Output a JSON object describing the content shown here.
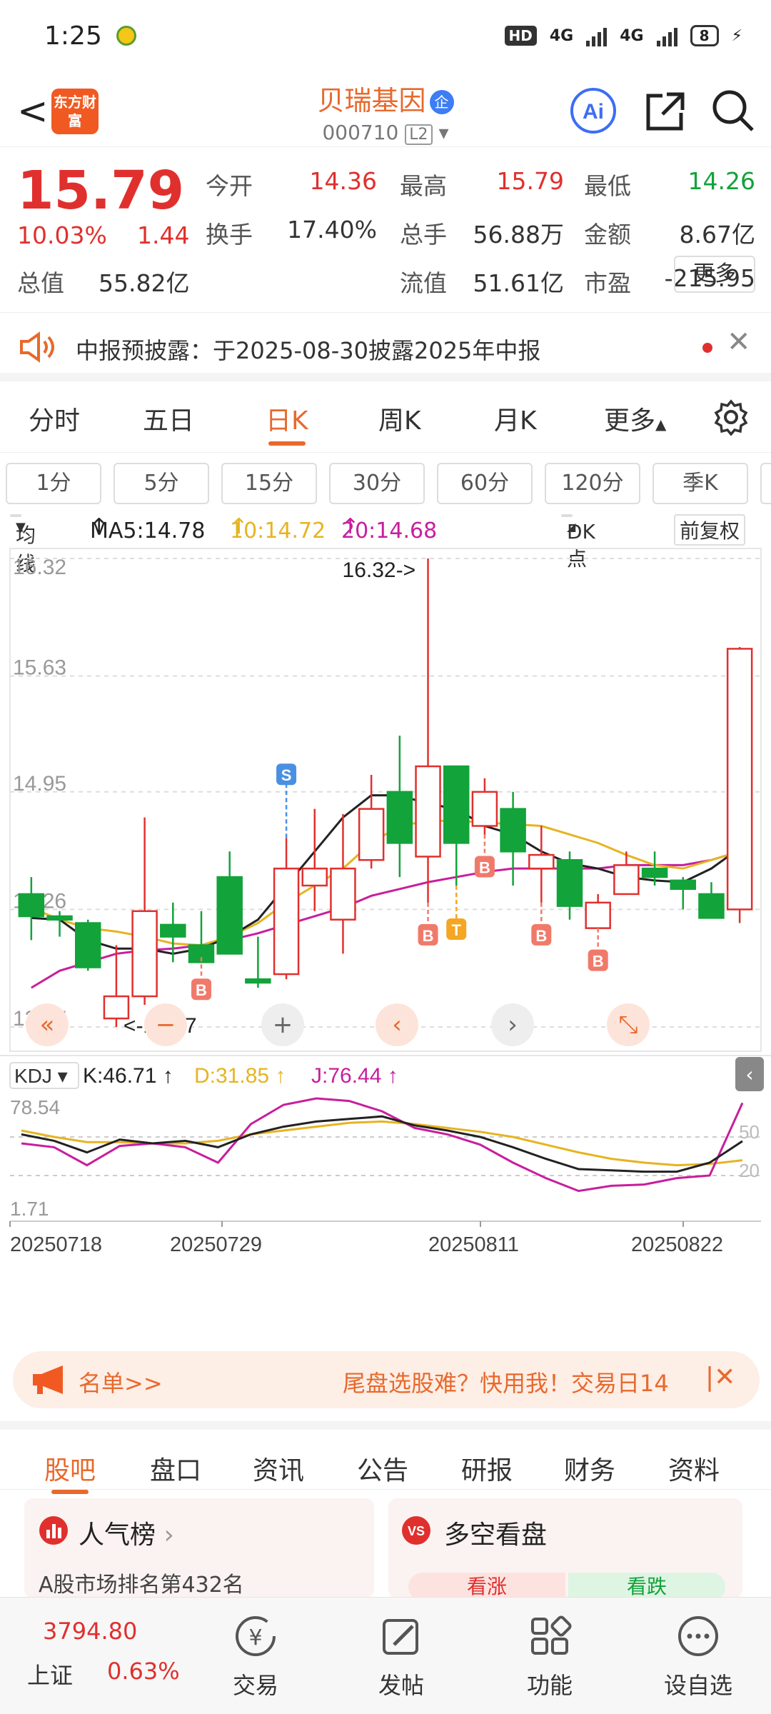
{
  "status": {
    "time": "1:25",
    "hd": "HD",
    "net1": "4G",
    "net2": "4G",
    "battery": "8"
  },
  "nav": {
    "logo": "东方财富",
    "name": "贝瑞基因",
    "badge": "企",
    "code": "000710",
    "level": "L2"
  },
  "quote": {
    "price": "15.79",
    "change_pct": "10.03%",
    "change": "1.44",
    "fields": [
      {
        "label": "今开",
        "value": "14.36",
        "color": "red"
      },
      {
        "label": "最高",
        "value": "15.79",
        "color": "red"
      },
      {
        "label": "最低",
        "value": "14.26",
        "color": "green"
      },
      {
        "label": "换手",
        "value": "17.40%",
        "color": "dark"
      },
      {
        "label": "总手",
        "value": "56.88万",
        "color": "dark"
      },
      {
        "label": "金额",
        "value": "8.67亿",
        "color": "dark"
      },
      {
        "label": "总值",
        "value": "55.82亿",
        "color": "dark"
      },
      {
        "label": "流值",
        "value": "51.61亿",
        "color": "dark"
      },
      {
        "label": "市盈",
        "value": "-215.95",
        "color": "dark"
      }
    ],
    "more": "更多"
  },
  "notice": {
    "text": "中报预披露：于2025-08-30披露2025年中报"
  },
  "chart_tabs": [
    "分时",
    "五日",
    "日K",
    "周K",
    "月K",
    "更多"
  ],
  "active_chart_tab": "日K",
  "periods": [
    "1分",
    "5分",
    "15分",
    "30分",
    "60分",
    "120分",
    "季K"
  ],
  "ma": {
    "selector": "均线",
    "ma5": "MA5:14.78",
    "ma10": "10:14.72",
    "ma20": "20:14.68",
    "dk": "DK点",
    "adjust": "前复权"
  },
  "kdj": {
    "selector": "KDJ",
    "k": "K:46.71",
    "d": "D:31.85",
    "j": "J:76.44"
  },
  "colors": {
    "up": "#e0302e",
    "down": "#12a33a",
    "accent": "#e8692c",
    "ma5": "#222222",
    "ma10": "#e6b422",
    "ma20": "#c81e9c"
  },
  "chart_data": {
    "type": "candlestick",
    "y_ticks": [
      "16.32",
      "15.63",
      "14.95",
      "14.26",
      "13.57"
    ],
    "ylim": [
      13.57,
      16.32
    ],
    "max_label": "16.32->",
    "min_label": "<-13.57",
    "x_labels": [
      "20250718",
      "20250729",
      "20250811",
      "20250822"
    ],
    "candles": [
      {
        "o": 14.35,
        "h": 14.45,
        "l": 14.08,
        "c": 14.22
      },
      {
        "o": 14.22,
        "h": 14.25,
        "l": 14.1,
        "c": 14.2
      },
      {
        "o": 14.18,
        "h": 14.2,
        "l": 13.9,
        "c": 13.92
      },
      {
        "o": 13.62,
        "h": 14.05,
        "l": 13.57,
        "c": 13.75
      },
      {
        "o": 13.75,
        "h": 14.8,
        "l": 13.7,
        "c": 14.25
      },
      {
        "o": 14.17,
        "h": 14.3,
        "l": 13.95,
        "c": 14.1
      },
      {
        "o": 14.05,
        "h": 14.25,
        "l": 13.98,
        "c": 13.95
      },
      {
        "o": 14.45,
        "h": 14.6,
        "l": 14.0,
        "c": 14.0
      },
      {
        "o": 13.85,
        "h": 14.1,
        "l": 13.8,
        "c": 13.83
      },
      {
        "o": 13.88,
        "h": 14.68,
        "l": 13.85,
        "c": 14.5
      },
      {
        "o": 14.4,
        "h": 14.85,
        "l": 14.25,
        "c": 14.5
      },
      {
        "o": 14.2,
        "h": 14.82,
        "l": 14.0,
        "c": 14.5
      },
      {
        "o": 14.55,
        "h": 15.05,
        "l": 14.5,
        "c": 14.85
      },
      {
        "o": 14.95,
        "h": 15.28,
        "l": 14.45,
        "c": 14.65
      },
      {
        "o": 14.57,
        "h": 16.32,
        "l": 14.3,
        "c": 15.1
      },
      {
        "o": 15.1,
        "h": 15.0,
        "l": 14.4,
        "c": 14.65
      },
      {
        "o": 14.75,
        "h": 15.03,
        "l": 14.7,
        "c": 14.95
      },
      {
        "o": 14.85,
        "h": 14.95,
        "l": 14.4,
        "c": 14.6
      },
      {
        "o": 14.5,
        "h": 14.75,
        "l": 14.3,
        "c": 14.58
      },
      {
        "o": 14.55,
        "h": 14.6,
        "l": 14.2,
        "c": 14.28
      },
      {
        "o": 14.15,
        "h": 14.35,
        "l": 14.15,
        "c": 14.3
      },
      {
        "o": 14.35,
        "h": 14.6,
        "l": 14.35,
        "c": 14.52
      },
      {
        "o": 14.5,
        "h": 14.6,
        "l": 14.4,
        "c": 14.45
      },
      {
        "o": 14.43,
        "h": 14.45,
        "l": 14.26,
        "c": 14.38
      },
      {
        "o": 14.35,
        "h": 14.42,
        "l": 14.23,
        "c": 14.21
      },
      {
        "o": 14.26,
        "h": 15.8,
        "l": 14.18,
        "c": 15.79
      }
    ],
    "ma5": [
      14.21,
      14.2,
      14.08,
      14.03,
      14.03,
      14.0,
      14.03,
      14.1,
      14.2,
      14.4,
      14.6,
      14.8,
      14.93,
      14.93,
      14.88,
      14.85,
      14.75,
      14.7,
      14.6,
      14.53,
      14.5,
      14.45,
      14.43,
      14.42,
      14.5,
      14.62
    ],
    "ma10": [
      14.27,
      14.2,
      14.15,
      14.13,
      14.1,
      14.06,
      14.05,
      14.1,
      14.18,
      14.3,
      14.4,
      14.5,
      14.65,
      14.75,
      14.78,
      14.78,
      14.77,
      14.76,
      14.75,
      14.7,
      14.65,
      14.58,
      14.52,
      14.5,
      14.55,
      14.6
    ],
    "ma20": [
      13.8,
      13.9,
      13.95,
      14.0,
      14.02,
      14.03,
      14.05,
      14.08,
      14.12,
      14.17,
      14.22,
      14.27,
      14.34,
      14.38,
      14.42,
      14.45,
      14.48,
      14.5,
      14.5,
      14.5,
      14.5,
      14.52,
      14.52,
      14.52,
      14.55,
      14.6
    ],
    "signals": [
      {
        "i": 6,
        "label": "B"
      },
      {
        "i": 9,
        "label": "S"
      },
      {
        "i": 14,
        "label": "B"
      },
      {
        "i": 15,
        "label": "T"
      },
      {
        "i": 16,
        "label": "B"
      },
      {
        "i": 18,
        "label": "B"
      },
      {
        "i": 20,
        "label": "B"
      }
    ],
    "kdj_ticks": [
      "78.54",
      "1.71"
    ],
    "kdj_right_ticks": [
      "50",
      "20"
    ],
    "k": [
      52,
      47,
      38,
      48,
      45,
      47,
      42,
      52,
      58,
      62,
      64,
      66,
      59,
      55,
      50,
      42,
      33,
      25,
      24,
      23,
      23,
      30,
      46.71
    ],
    "d": [
      55,
      50,
      46,
      46,
      45,
      45,
      47,
      52,
      55,
      58,
      61,
      62,
      60,
      57,
      54,
      50,
      44,
      38,
      33,
      30,
      28,
      29,
      31.85
    ],
    "j": [
      45,
      42,
      28,
      43,
      45,
      42,
      30,
      60,
      75,
      80,
      78,
      70,
      57,
      52,
      44,
      30,
      18,
      8,
      12,
      13,
      18,
      20,
      76.44
    ]
  },
  "ad": {
    "left": "名单>>",
    "right": "尾盘选股难？快用我！交易日14"
  },
  "bottom_tabs": [
    "股吧",
    "盘口",
    "资讯",
    "公告",
    "研报",
    "财务",
    "资料"
  ],
  "cards": {
    "left_title": "人气榜",
    "left_sub": "A股市场排名第432名",
    "right_title": "多空看盘",
    "up": "看涨",
    "down": "看跌"
  },
  "tabbar": {
    "index_value": "3794.80",
    "index_name": "上证",
    "index_pct": "0.63%",
    "items": [
      "交易",
      "发帖",
      "功能",
      "设自选"
    ]
  }
}
